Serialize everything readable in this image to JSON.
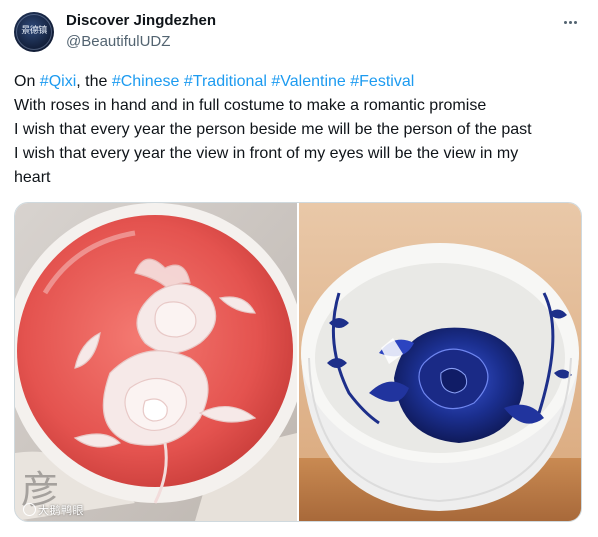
{
  "author": {
    "name": "Discover Jingdezhen",
    "handle": "@BeautifulUDZ",
    "avatar_icon": "porcelain-logo-avatar",
    "avatar_text": "景德镇"
  },
  "more_icon": "more-horizontal-icon",
  "tweet": {
    "line1": {
      "pre": "On ",
      "tag1": "#Qixi",
      "mid": ", the ",
      "tag2": "#Chinese",
      "tag3": "#Traditional",
      "tag4": "#Valentine",
      "tag5": "#Festival"
    },
    "line2": "With roses in hand and in full costume to make a romantic promise",
    "line3": "I wish that every year the person beside me will be the person of the past",
    "line4": "I wish that every year the view in front of my eyes will be the view in my",
    "line5": "heart"
  },
  "media": {
    "left_image": "red-glazed-cup-with-white-rose",
    "right_image": "blue-and-white-porcelain-bowl-with-rose",
    "watermark": "大鹅鸭眼"
  },
  "colors": {
    "link": "#1d9bf0",
    "secondary_text": "#536471",
    "cup_red": "#e45a57",
    "porcelain_blue": "#1b2f8f"
  }
}
